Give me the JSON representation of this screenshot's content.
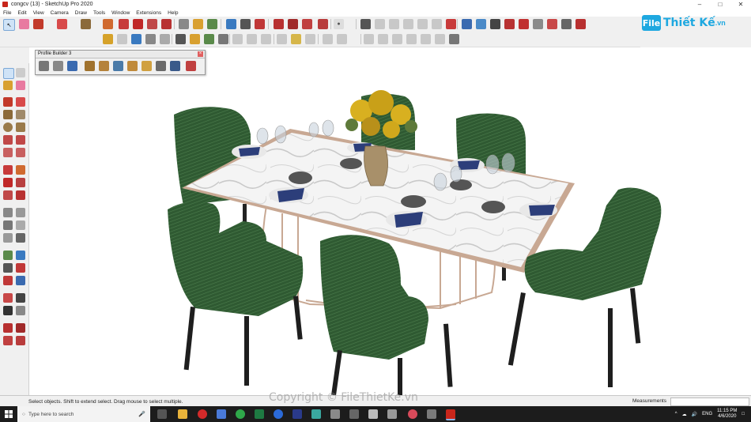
{
  "window": {
    "title": "congcv (13) - SketchUp Pro 2020",
    "minimize": "–",
    "maximize": "□",
    "close": "✕"
  },
  "menu": [
    "File",
    "Edit",
    "View",
    "Camera",
    "Draw",
    "Tools",
    "Window",
    "Extensions",
    "Help"
  ],
  "logo": {
    "box": "File",
    "text": "Thiết Kế",
    "suffix": ".vn"
  },
  "profile_builder": {
    "title": "Profile Builder 3",
    "close": "×"
  },
  "status": {
    "hint": "Select objects. Shift to extend select. Drag mouse to select multiple.",
    "measurements_label": "Measurements",
    "measurements_value": ""
  },
  "watermark": "Copyright © FileThietKe.vn",
  "taskbar": {
    "search_placeholder": "Type here to search",
    "lang": "ENG",
    "time": "11:15 PM",
    "date": "4/6/2020"
  },
  "colors": {
    "accent": "#1ea8e0",
    "chair": "#2f5a32",
    "table_top": "#f2f2f2",
    "frame": "#c8a893",
    "taskbar": "#1c1c1c"
  }
}
